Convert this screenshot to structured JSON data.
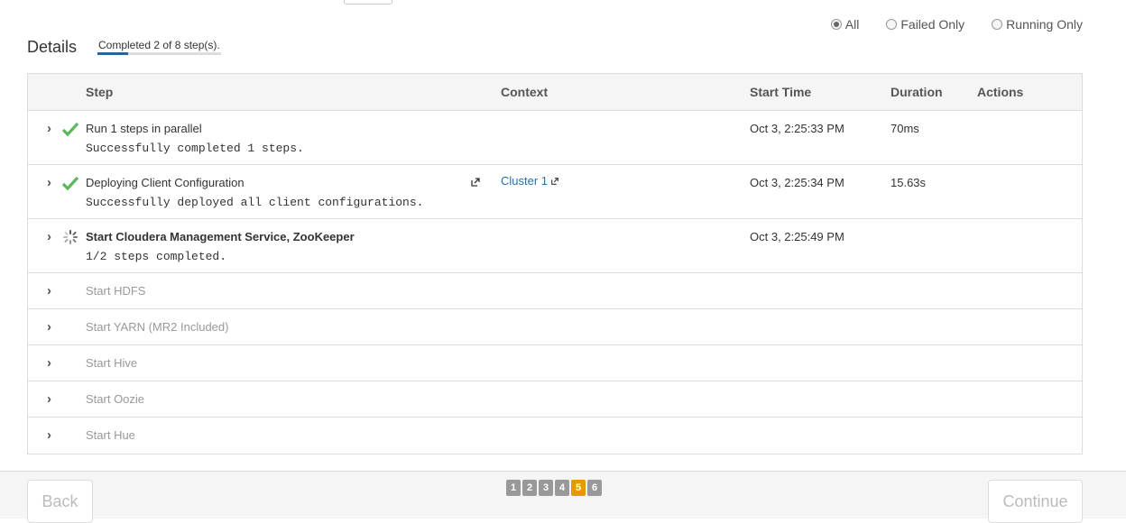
{
  "filters": [
    {
      "label": "All",
      "selected": true
    },
    {
      "label": "Failed Only",
      "selected": false
    },
    {
      "label": "Running Only",
      "selected": false
    }
  ],
  "details": {
    "title": "Details",
    "progress_text": "Completed 2 of 8 step(s).",
    "progress_fraction": 0.25
  },
  "table": {
    "headers": {
      "step": "Step",
      "context": "Context",
      "start_time": "Start Time",
      "duration": "Duration",
      "actions": "Actions"
    },
    "rows": [
      {
        "title": "Run 1 steps in parallel",
        "subtitle": "Successfully completed 1 steps.",
        "status": "success",
        "context": "",
        "start_time": "Oct 3, 2:25:33 PM",
        "duration": "70ms"
      },
      {
        "title": "Deploying Client Configuration",
        "subtitle": "Successfully deployed all client configurations.",
        "status": "success",
        "context": "Cluster 1",
        "start_time": "Oct 3, 2:25:34 PM",
        "duration": "15.63s"
      },
      {
        "title": "Start Cloudera Management Service, ZooKeeper",
        "subtitle": "1/2 steps completed.",
        "status": "running",
        "context": "",
        "start_time": "Oct 3, 2:25:49 PM",
        "duration": ""
      },
      {
        "title": "Start HDFS",
        "status": "pending"
      },
      {
        "title": "Start YARN (MR2 Included)",
        "status": "pending"
      },
      {
        "title": "Start Hive",
        "status": "pending"
      },
      {
        "title": "Start Oozie",
        "status": "pending"
      },
      {
        "title": "Start Hue",
        "status": "pending"
      }
    ]
  },
  "footer": {
    "back_label": "Back",
    "continue_label": "Continue",
    "pages": [
      "1",
      "2",
      "3",
      "4",
      "5",
      "6"
    ],
    "current_page": "5"
  },
  "colors": {
    "success": "#5cb85c",
    "link": "#2a6fa8",
    "current_page": "#e39b00"
  }
}
